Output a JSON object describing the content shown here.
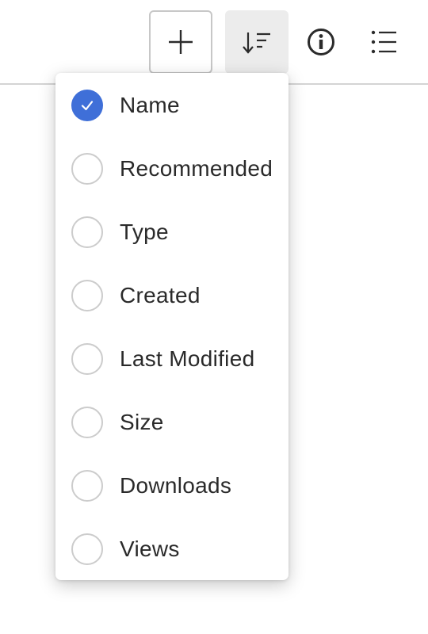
{
  "toolbar": {
    "buttons": [
      {
        "name": "add",
        "icon": "plus-icon"
      },
      {
        "name": "sort",
        "icon": "sort-descending-icon"
      },
      {
        "name": "info",
        "icon": "info-icon"
      },
      {
        "name": "view",
        "icon": "list-icon"
      }
    ]
  },
  "sort_menu": {
    "selected": "Name",
    "accent_color": "#3f6fd8",
    "items": [
      {
        "label": "Name",
        "checked": true
      },
      {
        "label": "Recommended",
        "checked": false
      },
      {
        "label": "Type",
        "checked": false
      },
      {
        "label": "Created",
        "checked": false
      },
      {
        "label": "Last Modified",
        "checked": false
      },
      {
        "label": "Size",
        "checked": false
      },
      {
        "label": "Downloads",
        "checked": false
      },
      {
        "label": "Views",
        "checked": false
      }
    ]
  }
}
